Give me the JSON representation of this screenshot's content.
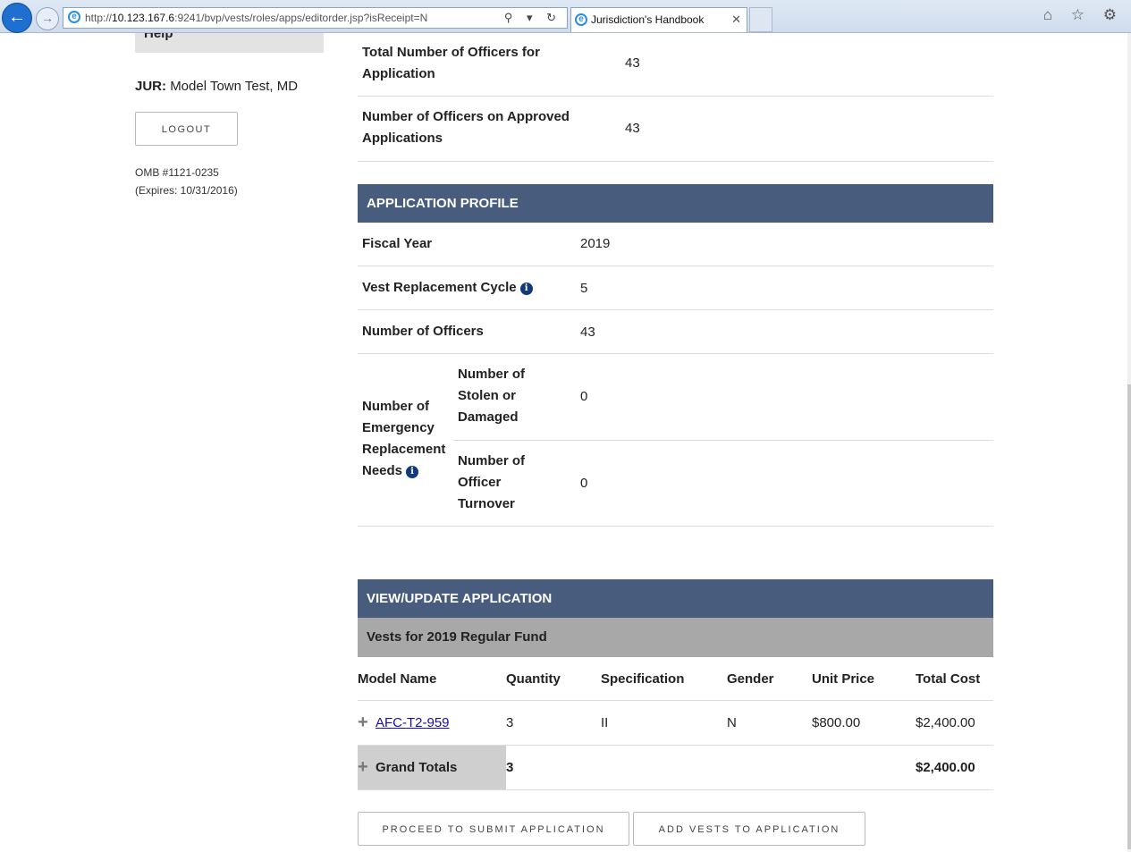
{
  "browser": {
    "url_prefix": "http://",
    "url_host": "10.123.167.6",
    "url_rest": ":9241/bvp/vests/roles/apps/editorder.jsp?isReceipt=N",
    "tab_title": "Jurisdiction's Handbook",
    "back_glyph": "←",
    "forward_glyph": "→",
    "addr_tools": "⚲ ▾ ↻",
    "close_glyph": "✕",
    "right_icons": "⌂ ☆ ⚙"
  },
  "sidebar": {
    "help_label": "Help",
    "jur_label": "JUR:",
    "jur_value": "Model Town Test, MD",
    "logout_label": "LOGOUT",
    "omb_number": "OMB #1121-0235",
    "omb_expires": "(Expires: 10/31/2016)"
  },
  "summary": {
    "total_officers_label": "Total Number of Officers for Application",
    "total_officers_value": "43",
    "approved_officers_label": "Number of Officers on Approved Applications",
    "approved_officers_value": "43"
  },
  "profile": {
    "heading": "APPLICATION PROFILE",
    "fiscal_year_label": "Fiscal Year",
    "fiscal_year_value": "2019",
    "cycle_label": "Vest Replacement Cycle",
    "cycle_value": "5",
    "officers_label": "Number of Officers",
    "officers_value": "43",
    "emergency_label": "Number of Emergency Replacement Needs",
    "stolen_label": "Number of Stolen or Damaged",
    "stolen_value": "0",
    "turnover_label": "Number of Officer Turnover",
    "turnover_value": "0",
    "info_glyph": "i"
  },
  "application": {
    "heading": "VIEW/UPDATE APPLICATION",
    "subheading": "Vests for 2019 Regular Fund",
    "columns": [
      "Model Name",
      "Quantity",
      "Specification",
      "Gender",
      "Unit Price",
      "Total Cost"
    ],
    "rows": [
      {
        "model": "AFC-T2-959",
        "quantity": "3",
        "specification": "II",
        "gender": "N",
        "unit_price": "$800.00",
        "total_cost": "$2,400.00"
      }
    ],
    "grand_totals_label": "Grand Totals",
    "grand_quantity": "3",
    "grand_total_cost": "$2,400.00",
    "expand_glyph": "+",
    "proceed_label": "PROCEED TO SUBMIT APPLICATION",
    "add_label": "ADD VESTS TO APPLICATION"
  }
}
